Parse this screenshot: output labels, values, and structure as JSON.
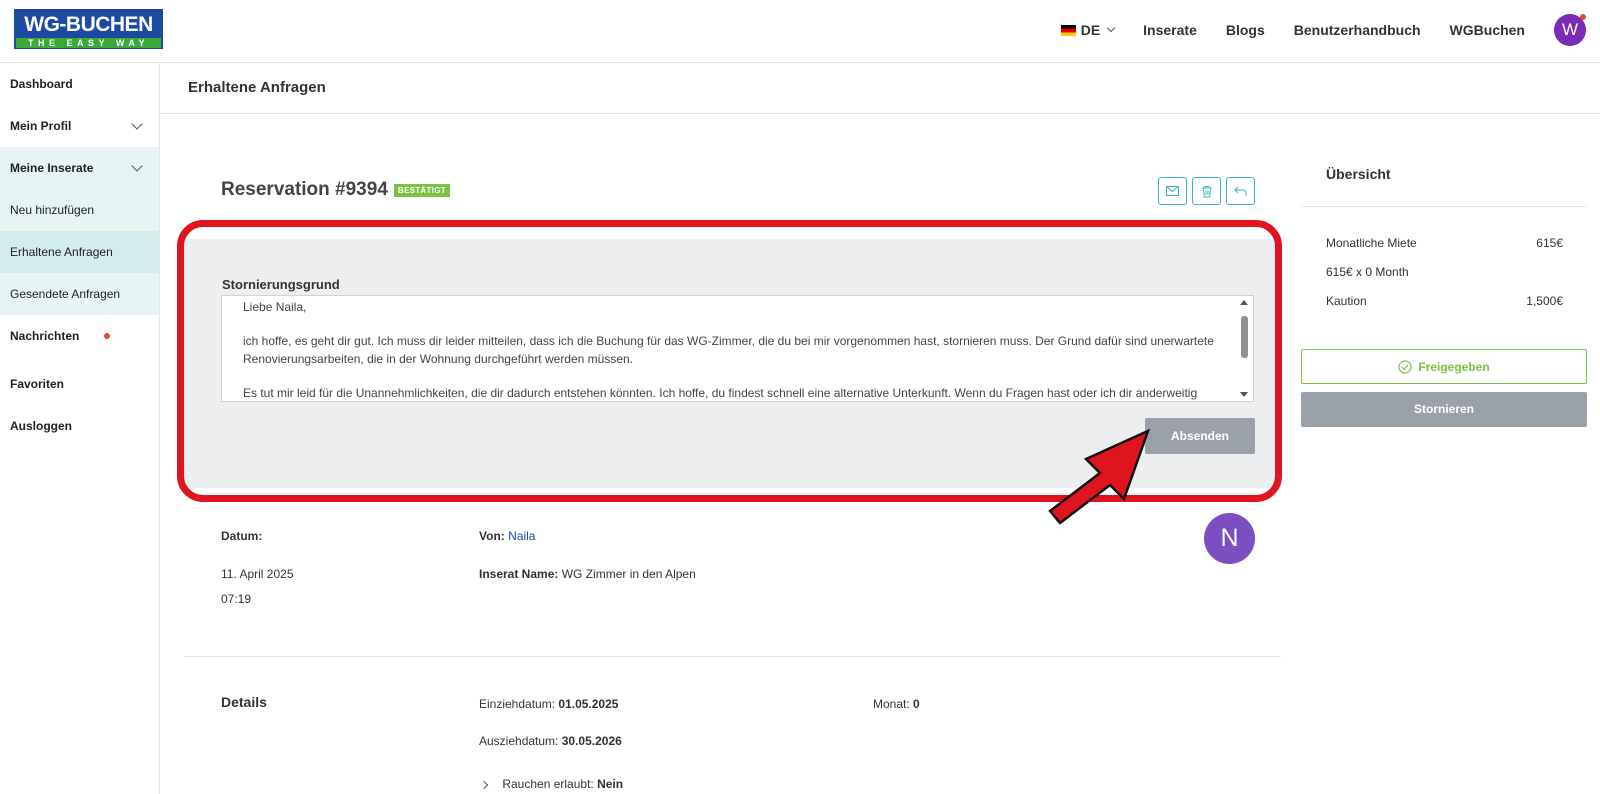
{
  "header": {
    "logo_top": "WG-BUCHEN",
    "logo_bottom": "THE EASY WAY",
    "lang": "DE",
    "nav": [
      "Inserate",
      "Blogs",
      "Benutzerhandbuch",
      "WGBuchen"
    ],
    "avatar_letter": "W"
  },
  "sidebar": {
    "items": [
      {
        "label": "Dashboard"
      },
      {
        "label": "Mein Profil"
      },
      {
        "label": "Meine Inserate"
      },
      {
        "label": "Neu hinzufügen"
      },
      {
        "label": "Erhaltene Anfragen"
      },
      {
        "label": "Gesendete Anfragen"
      },
      {
        "label": "Nachrichten"
      },
      {
        "label": "Favoriten"
      },
      {
        "label": "Ausloggen"
      }
    ]
  },
  "page": {
    "title": "Erhaltene Anfragen"
  },
  "reservation": {
    "title": "Reservation #9394",
    "status": "BESTÄTIGT"
  },
  "cancel_form": {
    "label": "Stornierungsgrund",
    "text_lines": [
      "Liebe Naila,",
      "ich hoffe, es geht dir gut. Ich muss dir leider mitteilen, dass ich die Buchung für das WG-Zimmer, die du bei mir vorgenommen hast, stornieren muss. Der Grund dafür sind unerwartete Renovierungsarbeiten, die in der Wohnung durchgeführt werden müssen.",
      "Es tut mir leid für die Unannehmlichkeiten, die dir dadurch entstehen könnten. Ich hoffe, du findest schnell eine alternative Unterkunft. Wenn du Fragen hast oder ich dir anderweitig"
    ],
    "submit_label": "Absenden"
  },
  "info": {
    "date_label": "Datum:",
    "date_value": "11. April 2025",
    "time_value": "07:19",
    "from_label": "Von:",
    "from_value": "Naila",
    "listing_label": "Inserat Name:",
    "listing_value": "WG Zimmer in den Alpen",
    "sender_avatar": "N"
  },
  "details": {
    "heading": "Details",
    "move_in_label": "Einziehdatum:",
    "move_in_value": "01.05.2025",
    "move_out_label": "Ausziehdatum:",
    "move_out_value": "30.05.2026",
    "month_label": "Monat:",
    "month_value": "0",
    "smoking_label": "Rauchen erlaubt:",
    "smoking_value": "Nein"
  },
  "overview": {
    "title": "Übersicht",
    "rent_label": "Monatliche Miete",
    "rent_value": "615€",
    "calc_label": "615€ x 0 Month",
    "deposit_label": "Kaution",
    "deposit_value": "1,500€",
    "release_label": "Freigegeben",
    "cancel_label": "Stornieren"
  },
  "colors": {
    "brand_blue": "#1c4aa0",
    "brand_green": "#3aa935",
    "accent_teal": "#3ab5bd",
    "status_green": "#7cc242",
    "highlight_red": "#e0141e"
  }
}
